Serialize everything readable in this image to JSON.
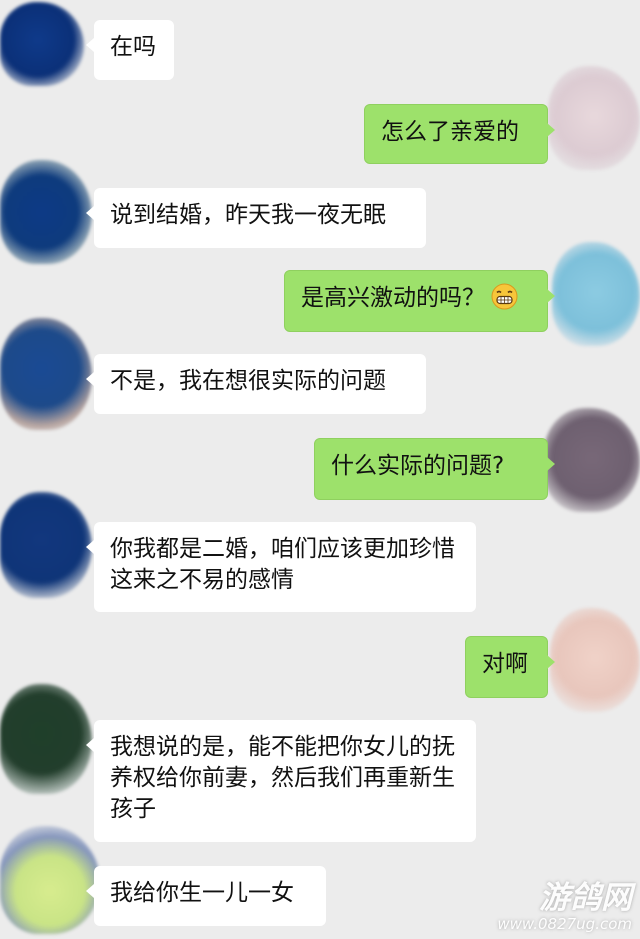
{
  "messages": [
    {
      "side": "in",
      "text": "在吗"
    },
    {
      "side": "out",
      "text": "怎么了亲爱的"
    },
    {
      "side": "in",
      "text": "说到结婚，昨天我一夜无眠"
    },
    {
      "side": "out",
      "text": "是高兴激动的吗？",
      "emoji": "grinning-face-emoji"
    },
    {
      "side": "in",
      "text": "不是，我在想很实际的问题"
    },
    {
      "side": "out",
      "text": "什么实际的问题?"
    },
    {
      "side": "in",
      "text": "你我都是二婚，咱们应该更加珍惜这来之不易的感情"
    },
    {
      "side": "out",
      "text": "对啊"
    },
    {
      "side": "in",
      "text": "我想说的是，能不能把你女儿的抚养权给你前妻，然后我们再重新生孩子"
    },
    {
      "side": "in",
      "text": "我给你生一儿一女"
    }
  ],
  "watermark": {
    "title": "游鸽网",
    "url": "www.0827ug.com"
  },
  "colors": {
    "background": "#ececec",
    "incoming_bubble": "#ffffff",
    "outgoing_bubble": "#9de16b"
  }
}
